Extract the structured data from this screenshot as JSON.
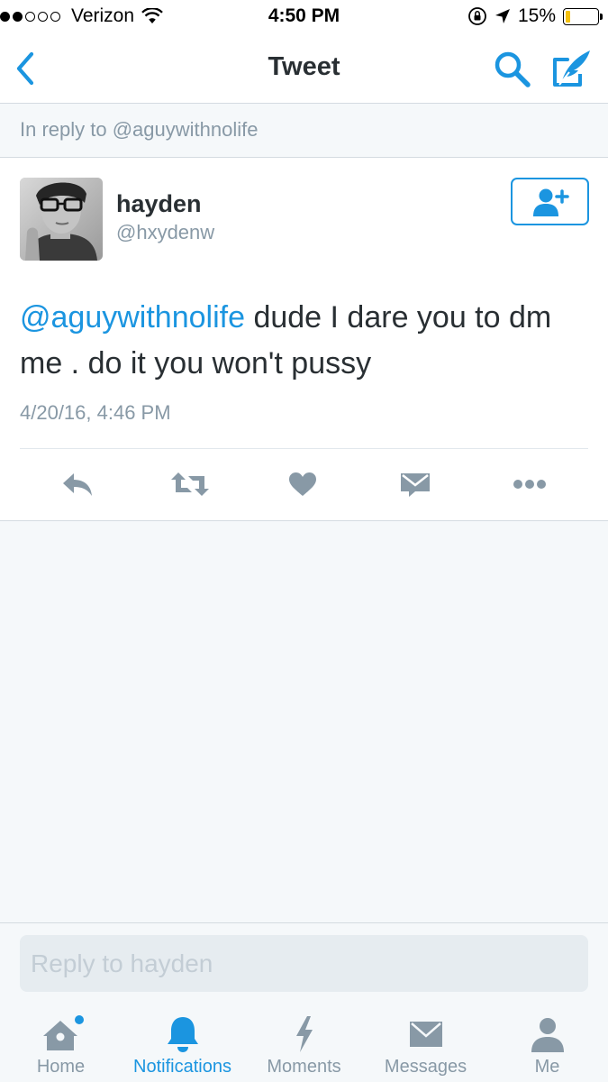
{
  "status_bar": {
    "carrier": "Verizon",
    "time": "4:50 PM",
    "battery_percent": "15%",
    "battery_level": 0.15,
    "signal_bars_filled": 2,
    "signal_bars_total": 5
  },
  "nav": {
    "title": "Tweet",
    "back_icon": "chevron-left-icon",
    "search_icon": "search-icon",
    "compose_icon": "compose-icon"
  },
  "reply_context": "In reply to @aguywithnolife",
  "tweet": {
    "author_name": "hayden",
    "author_handle": "@hxydenw",
    "mention": "@aguywithnolife",
    "text": " dude I dare you to dm me . do it you won't pussy",
    "timestamp": "4/20/16, 4:46 PM",
    "actions": [
      "reply-icon",
      "retweet-icon",
      "like-icon",
      "direct-message-icon",
      "more-icon"
    ]
  },
  "reply": {
    "placeholder": "Reply to hayden"
  },
  "tabs": [
    {
      "label": "Home",
      "icon": "home-icon",
      "active": false,
      "has_badge": true
    },
    {
      "label": "Notifications",
      "icon": "bell-icon",
      "active": true
    },
    {
      "label": "Moments",
      "icon": "lightning-icon",
      "active": false
    },
    {
      "label": "Messages",
      "icon": "envelope-icon",
      "active": false
    },
    {
      "label": "Me",
      "icon": "person-icon",
      "active": false
    }
  ],
  "colors": {
    "accent": "#1b95e0",
    "icon_gray": "#8899a6",
    "background": "#f5f8fa",
    "battery_fill": "#f5c10e"
  }
}
